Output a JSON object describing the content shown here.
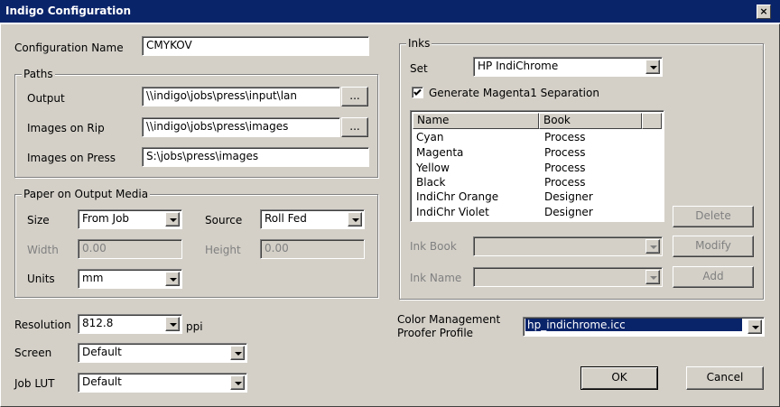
{
  "window": {
    "title": "Indigo Configuration",
    "close_label": "×"
  },
  "config_name": {
    "label": "Configuration Name",
    "value": "CMYKOV"
  },
  "paths": {
    "legend": "Paths",
    "output": {
      "label": "Output",
      "value": "\\\\indigo\\jobs\\press\\input\\lan",
      "browse": "..."
    },
    "images_on_rip": {
      "label": "Images on Rip",
      "value": "\\\\indigo\\jobs\\press\\images",
      "browse": "..."
    },
    "images_on_press": {
      "label": "Images on Press",
      "value": "S:\\jobs\\press\\images"
    }
  },
  "paper": {
    "legend": "Paper on Output Media",
    "size": {
      "label": "Size",
      "value": "From Job"
    },
    "source": {
      "label": "Source",
      "value": "Roll Fed"
    },
    "width": {
      "label": "Width",
      "value": "0.00"
    },
    "height": {
      "label": "Height",
      "value": "0.00"
    },
    "units": {
      "label": "Units",
      "value": "mm"
    }
  },
  "resolution": {
    "label": "Resolution",
    "value": "812.8",
    "unit": "ppi"
  },
  "screen": {
    "label": "Screen",
    "value": "Default"
  },
  "job_lut": {
    "label": "Job LUT",
    "value": "Default"
  },
  "inks": {
    "legend": "Inks",
    "set": {
      "label": "Set",
      "value": "HP IndiChrome"
    },
    "generate_magenta": {
      "label": "Generate Magenta1 Separation",
      "checked": true
    },
    "columns": [
      "Name",
      "Book"
    ],
    "rows": [
      [
        "Cyan",
        "Process"
      ],
      [
        "Magenta",
        "Process"
      ],
      [
        "Yellow",
        "Process"
      ],
      [
        "Black",
        "Process"
      ],
      [
        "IndiChr Orange",
        "Designer"
      ],
      [
        "IndiChr Violet",
        "Designer"
      ]
    ],
    "ink_book_label": "Ink Book",
    "ink_name_label": "Ink Name",
    "delete": "Delete",
    "modify": "Modify",
    "add": "Add"
  },
  "color_management": {
    "label_line1": "Color Management",
    "label_line2": "Proofer Profile",
    "value": "hp_indichrome.icc"
  },
  "buttons": {
    "ok": "OK",
    "cancel": "Cancel"
  }
}
